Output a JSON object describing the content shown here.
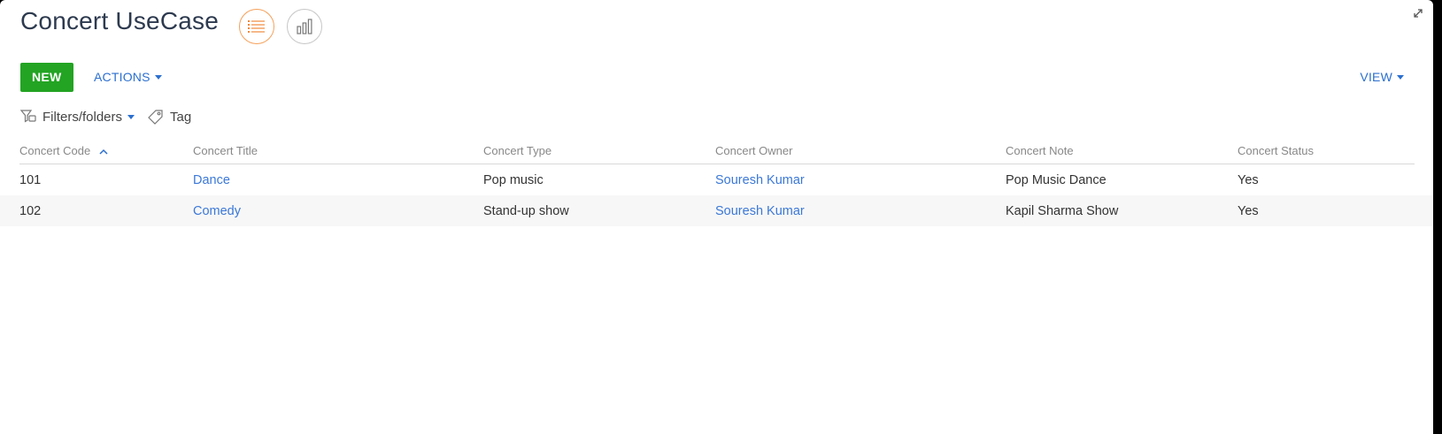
{
  "header": {
    "title": "Concert UseCase",
    "views": [
      {
        "icon": "list-view-icon",
        "active": true
      },
      {
        "icon": "chart-view-icon",
        "active": false
      }
    ],
    "expand_icon": "expand-icon"
  },
  "toolbar": {
    "new_label": "NEW",
    "actions_label": "ACTIONS",
    "view_label": "VIEW"
  },
  "filters": {
    "filters_label": "Filters/folders",
    "tag_label": "Tag"
  },
  "table": {
    "columns": [
      "Concert Code",
      "Concert Title",
      "Concert Type",
      "Concert Owner",
      "Concert Note",
      "Concert Status"
    ],
    "sorted_column": "Concert Code",
    "sort_direction": "ascending",
    "rows": [
      {
        "code": "101",
        "title": "Dance",
        "type": "Pop music",
        "owner": "Souresh Kumar",
        "note": "Pop Music Dance",
        "status": "Yes"
      },
      {
        "code": "102",
        "title": "Comedy",
        "type": "Stand-up show",
        "owner": "Souresh Kumar",
        "note": "Kapil Sharma Show",
        "status": "Yes"
      }
    ]
  },
  "colors": {
    "accent_orange": "#f5a05a",
    "new_button_green": "#23a423",
    "link_blue": "#3b78d8"
  }
}
